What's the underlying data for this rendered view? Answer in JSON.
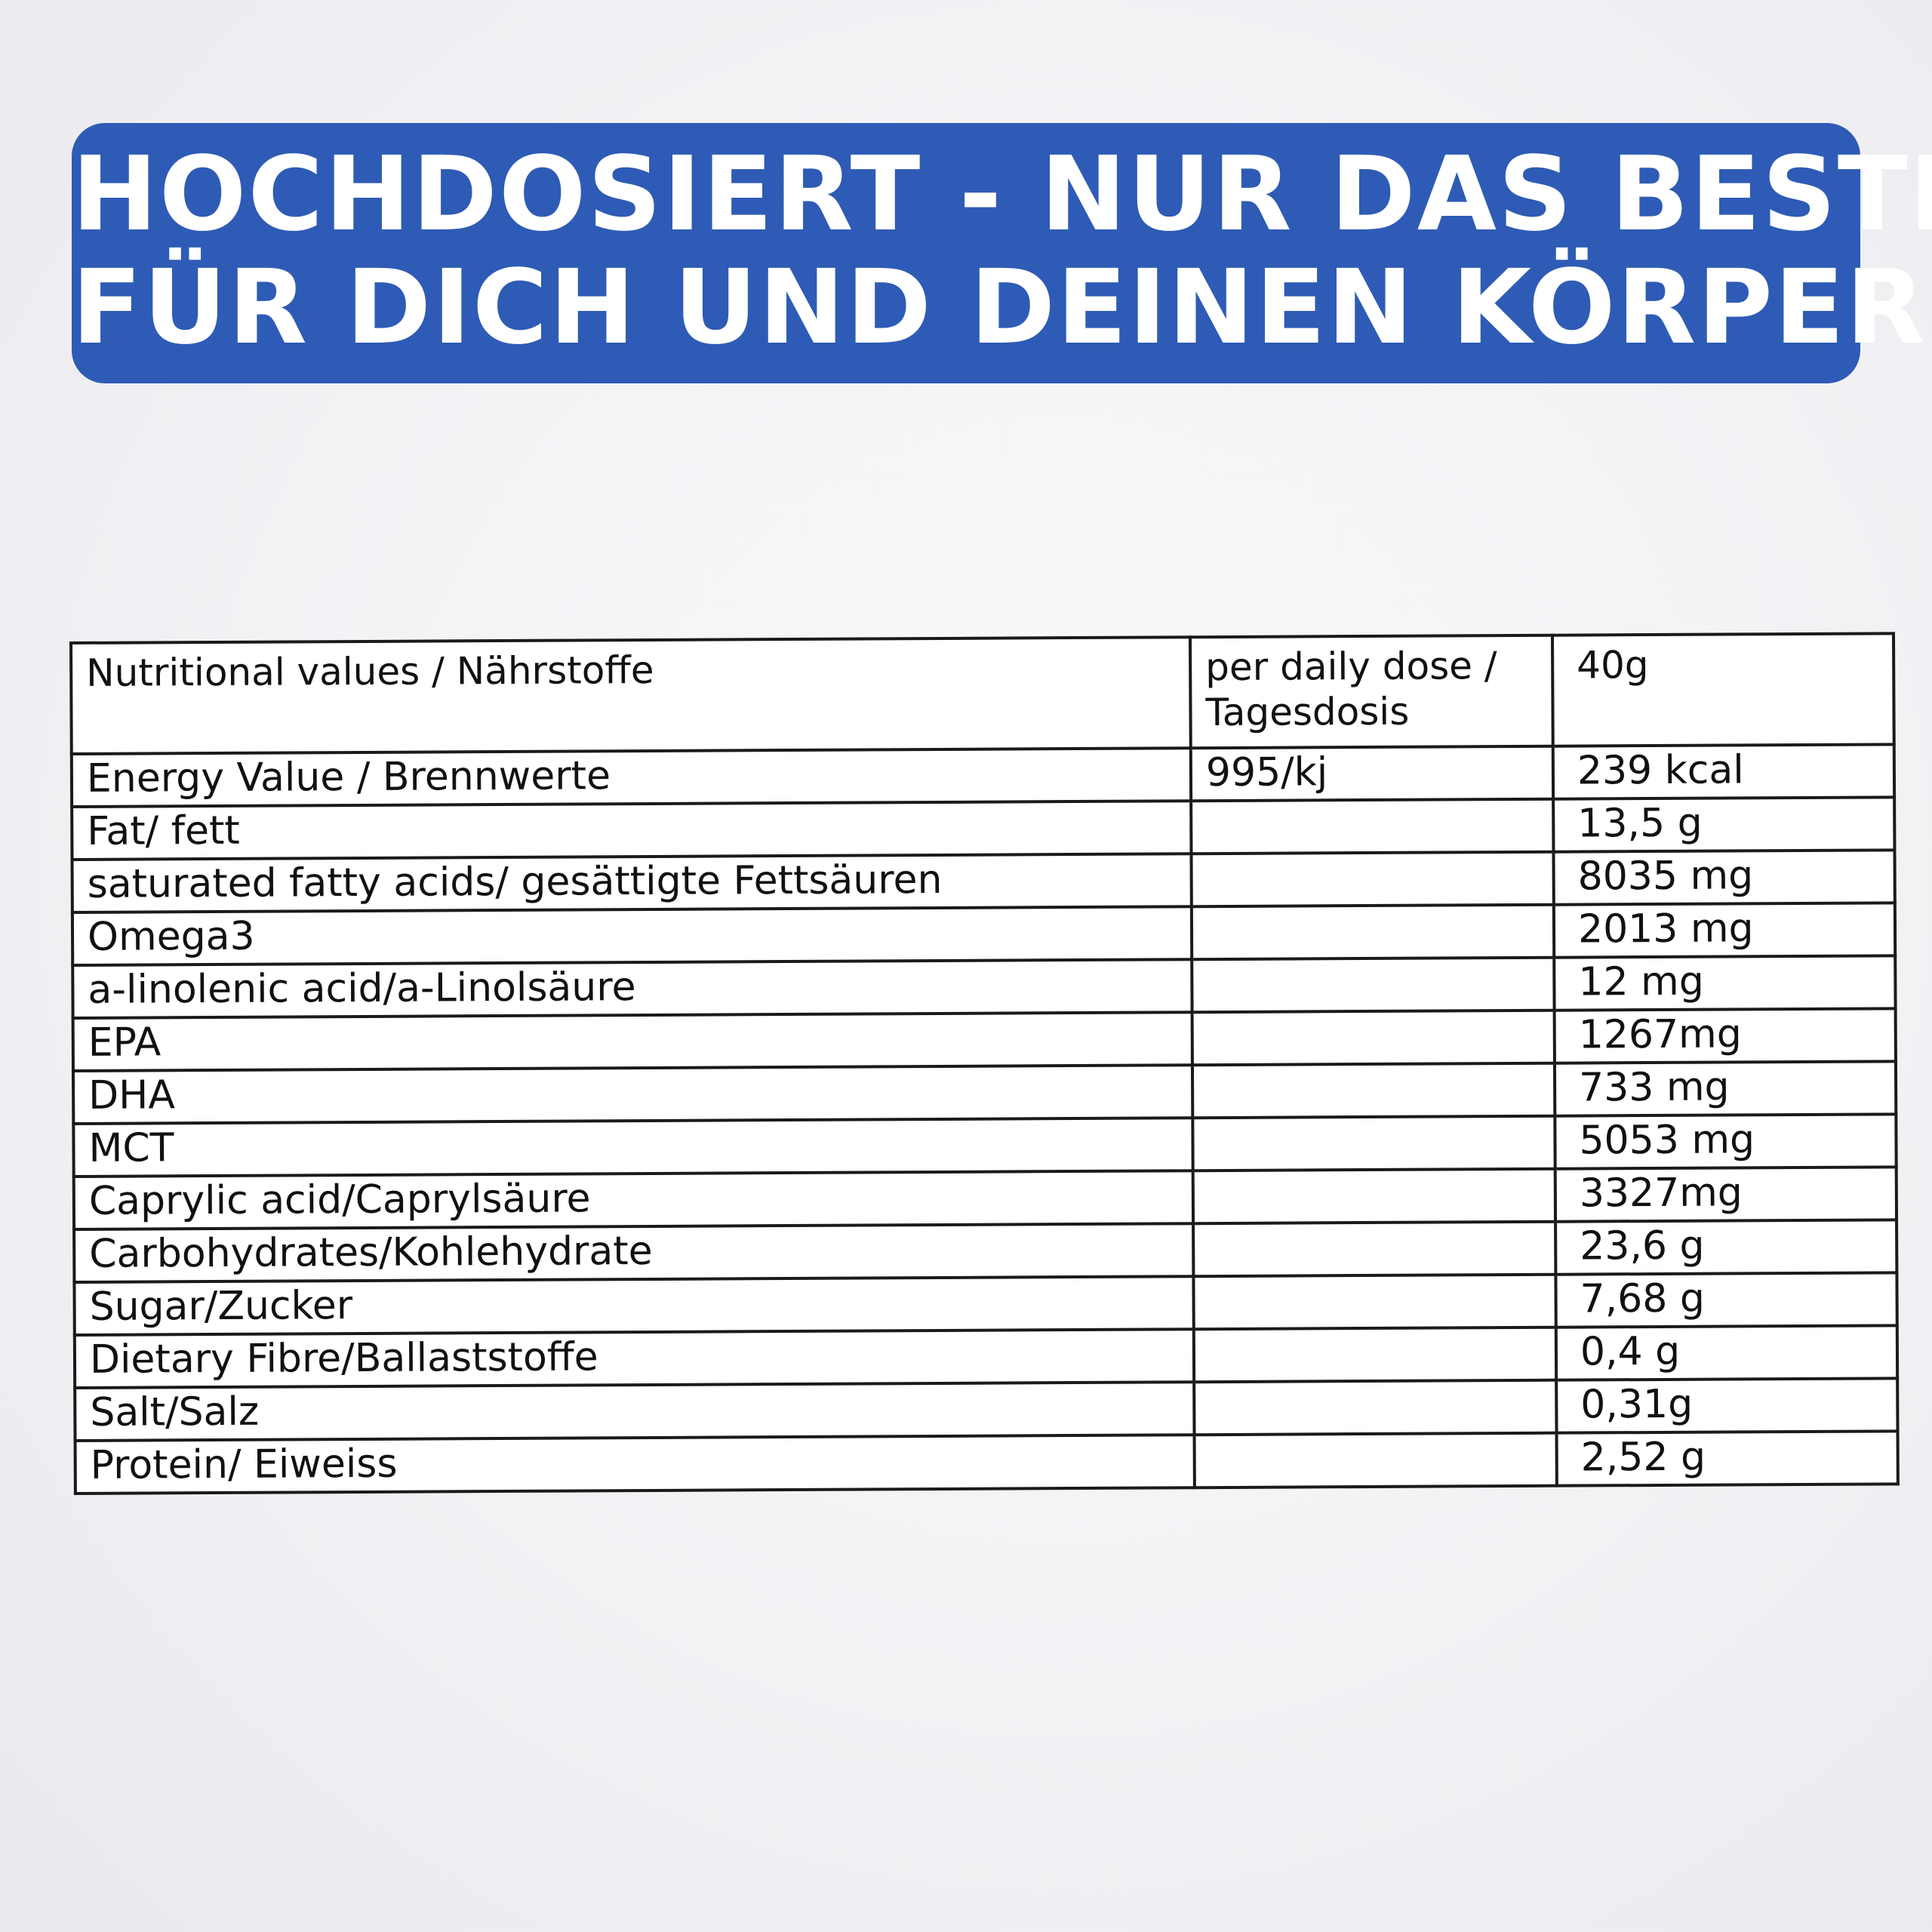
{
  "banner": {
    "line1": "HOCHDOSIERT - NUR DAS BESTE",
    "line2": "FÜR DICH UND DEINEN KÖRPER",
    "bg_color": "#2e5bb5",
    "text_color": "#ffffff"
  },
  "table": {
    "header": {
      "col1": "Nutritional values / Nährstoffe",
      "col2": "per daily dose / Tagesdosis",
      "col3": "40g"
    },
    "rows": [
      {
        "name": "Energy Value / Brennwerte",
        "dose": "995/kj",
        "value": "239 kcal"
      },
      {
        "name": "Fat/ fett",
        "dose": "",
        "value": "13,5 g"
      },
      {
        "name": "saturated fatty acids/ gesättigte Fettsäuren",
        "dose": "",
        "value": "8035 mg"
      },
      {
        "name": "Omega3",
        "dose": "",
        "value": "2013 mg"
      },
      {
        "name": "a-linolenic acid/a-Linolsäure",
        "dose": "",
        "value": "12 mg"
      },
      {
        "name": "EPA",
        "dose": "",
        "value": "1267mg"
      },
      {
        "name": "DHA",
        "dose": "",
        "value": "733 mg"
      },
      {
        "name": "MCT",
        "dose": "",
        "value": "5053 mg"
      },
      {
        "name": "Caprylic acid/Caprylsäure",
        "dose": "",
        "value": "3327mg"
      },
      {
        "name": "Carbohydrates/Kohlehydrate",
        "dose": "",
        "value": "23,6 g"
      },
      {
        "name": "Sugar/Zucker",
        "dose": "",
        "value": "7,68 g"
      },
      {
        "name": "Dietary Fibre/Ballaststoffe",
        "dose": "",
        "value": "0,4 g"
      },
      {
        "name": "Salt/Salz",
        "dose": "",
        "value": "0,31g"
      },
      {
        "name": "Protein/ Eiweiss",
        "dose": "",
        "value": "2,52 g"
      }
    ]
  }
}
